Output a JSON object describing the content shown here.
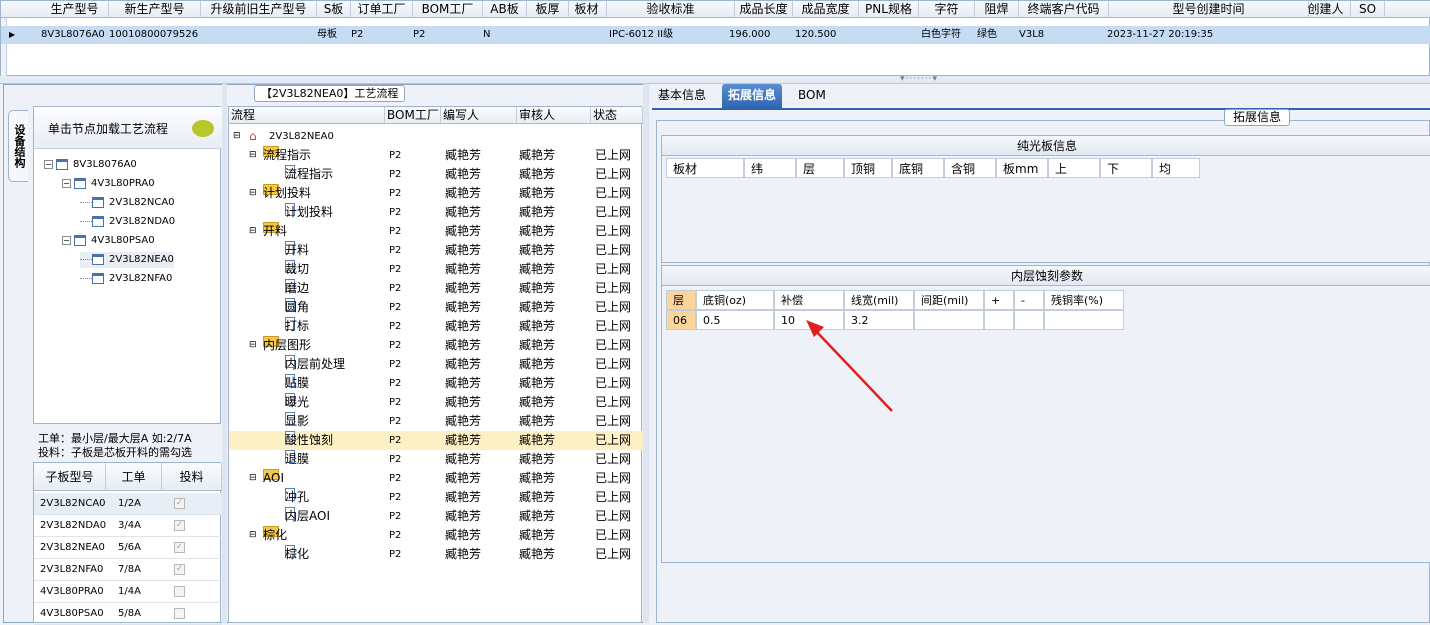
{
  "top_grid": {
    "headers": [
      "生产型号",
      "新生产型号",
      "升级前旧生产型号",
      "S板",
      "订单工厂",
      "BOM工厂",
      "AB板",
      "板厚",
      "板材",
      "验收标准",
      "成品长度",
      "成品宽度",
      "PNL规格",
      "字符",
      "阻焊",
      "终端客户代码",
      "型号创建时间",
      "创建人",
      "SO"
    ],
    "row": [
      "8V3L8076A0",
      "10010800079526",
      "",
      "母板",
      "P2",
      "P2",
      "N",
      "",
      "",
      "IPC-6012 II级",
      "196.000",
      "120.500",
      "",
      "白色字符",
      "绿色",
      "V3L8",
      "2023-11-27 20:19:35",
      "",
      ""
    ]
  },
  "left": {
    "side_tab": "设备结构",
    "process_title": "【2V3L82NEA0】工艺流程",
    "load_button": "单击节点加载工艺流程",
    "tree": [
      {
        "label": "8V3L8076A0",
        "level": 0,
        "expand": "−"
      },
      {
        "label": "4V3L80PRA0",
        "level": 1,
        "expand": "−"
      },
      {
        "label": "2V3L82NCA0",
        "level": 2,
        "expand": ""
      },
      {
        "label": "2V3L82NDA0",
        "level": 2,
        "expand": ""
      },
      {
        "label": "4V3L80PSA0",
        "level": 1,
        "expand": "−"
      },
      {
        "label": "2V3L82NEA0",
        "level": 2,
        "expand": ""
      },
      {
        "label": "2V3L82NFA0",
        "level": 2,
        "expand": ""
      }
    ],
    "note_line1": "工单：最小层/最大层A 如:2/7A",
    "note_line2": "投料：子板是芯板开料的需勾选",
    "child_table": {
      "headers": [
        "子板型号",
        "工单",
        "投料"
      ],
      "rows": [
        {
          "model": "2V3L82NCA0",
          "order": "1/2A",
          "checked": "✓"
        },
        {
          "model": "2V3L82NDA0",
          "order": "3/4A",
          "checked": "✓"
        },
        {
          "model": "2V3L82NEA0",
          "order": "5/6A",
          "checked": "✓"
        },
        {
          "model": "2V3L82NFA0",
          "order": "7/8A",
          "checked": "✓"
        },
        {
          "model": "4V3L80PRA0",
          "order": "1/4A",
          "checked": ""
        },
        {
          "model": "4V3L80PSA0",
          "order": "5/8A",
          "checked": ""
        }
      ]
    },
    "process_grid": {
      "headers": [
        "流程",
        "BOM工厂",
        "编写人",
        "审核人",
        "状态"
      ],
      "root": "2V3L82NEA0",
      "rows": [
        {
          "name": "流程指示",
          "type": "folder",
          "bom": "P2",
          "writer": "臧艳芳",
          "reviewer": "臧艳芳",
          "status": "已上网"
        },
        {
          "name": "流程指示",
          "type": "doc",
          "bom": "P2",
          "writer": "臧艳芳",
          "reviewer": "臧艳芳",
          "status": "已上网"
        },
        {
          "name": "计划投料",
          "type": "folder",
          "bom": "P2",
          "writer": "臧艳芳",
          "reviewer": "臧艳芳",
          "status": "已上网"
        },
        {
          "name": "计划投料",
          "type": "doc",
          "bom": "P2",
          "writer": "臧艳芳",
          "reviewer": "臧艳芳",
          "status": "已上网"
        },
        {
          "name": "开料",
          "type": "folder",
          "bom": "P2",
          "writer": "臧艳芳",
          "reviewer": "臧艳芳",
          "status": "已上网"
        },
        {
          "name": "开料",
          "type": "doc",
          "bom": "P2",
          "writer": "臧艳芳",
          "reviewer": "臧艳芳",
          "status": "已上网"
        },
        {
          "name": "裁切",
          "type": "doc",
          "bom": "P2",
          "writer": "臧艳芳",
          "reviewer": "臧艳芳",
          "status": "已上网"
        },
        {
          "name": "磨边",
          "type": "doc",
          "bom": "P2",
          "writer": "臧艳芳",
          "reviewer": "臧艳芳",
          "status": "已上网"
        },
        {
          "name": "圆角",
          "type": "doc",
          "bom": "P2",
          "writer": "臧艳芳",
          "reviewer": "臧艳芳",
          "status": "已上网"
        },
        {
          "name": "打标",
          "type": "doc",
          "bom": "P2",
          "writer": "臧艳芳",
          "reviewer": "臧艳芳",
          "status": "已上网"
        },
        {
          "name": "内层图形",
          "type": "folder",
          "bom": "P2",
          "writer": "臧艳芳",
          "reviewer": "臧艳芳",
          "status": "已上网"
        },
        {
          "name": "内层前处理",
          "type": "doc",
          "bom": "P2",
          "writer": "臧艳芳",
          "reviewer": "臧艳芳",
          "status": "已上网"
        },
        {
          "name": "贴膜",
          "type": "doc",
          "bom": "P2",
          "writer": "臧艳芳",
          "reviewer": "臧艳芳",
          "status": "已上网"
        },
        {
          "name": "曝光",
          "type": "doc",
          "bom": "P2",
          "writer": "臧艳芳",
          "reviewer": "臧艳芳",
          "status": "已上网"
        },
        {
          "name": "显影",
          "type": "doc",
          "bom": "P2",
          "writer": "臧艳芳",
          "reviewer": "臧艳芳",
          "status": "已上网"
        },
        {
          "name": "酸性蚀刻",
          "type": "doc",
          "bom": "P2",
          "writer": "臧艳芳",
          "reviewer": "臧艳芳",
          "status": "已上网",
          "selected": true
        },
        {
          "name": "退膜",
          "type": "doc",
          "bom": "P2",
          "writer": "臧艳芳",
          "reviewer": "臧艳芳",
          "status": "已上网"
        },
        {
          "name": "AOI",
          "type": "folder",
          "bom": "P2",
          "writer": "臧艳芳",
          "reviewer": "臧艳芳",
          "status": "已上网"
        },
        {
          "name": "冲孔",
          "type": "doc",
          "bom": "P2",
          "writer": "臧艳芳",
          "reviewer": "臧艳芳",
          "status": "已上网"
        },
        {
          "name": "内层AOI",
          "type": "doc",
          "bom": "P2",
          "writer": "臧艳芳",
          "reviewer": "臧艳芳",
          "status": "已上网"
        },
        {
          "name": "棕化",
          "type": "folder",
          "bom": "P2",
          "writer": "臧艳芳",
          "reviewer": "臧艳芳",
          "status": "已上网"
        },
        {
          "name": "棕化",
          "type": "doc",
          "bom": "P2",
          "writer": "臧艳芳",
          "reviewer": "臧艳芳",
          "status": "已上网"
        }
      ]
    }
  },
  "right": {
    "tabs": [
      "基本信息",
      "拓展信息",
      "BOM"
    ],
    "ext_header": "拓展信息",
    "plain_board": {
      "title": "纯光板信息",
      "headers": [
        "板材",
        "纬",
        "层",
        "顶铜",
        "底铜",
        "含铜",
        "板mm",
        "上",
        "下",
        "均"
      ]
    },
    "inner_etch": {
      "title": "内层蚀刻参数",
      "headers": [
        "层",
        "底铜(oz)",
        "补偿",
        "线宽(mil)",
        "间距(mil)",
        "+",
        "-",
        "残铜率(%)"
      ],
      "row": [
        "06",
        "0.5",
        "10",
        "3.2",
        "",
        "",
        "",
        ""
      ]
    }
  },
  "colors": {
    "accent": "#2f65b0",
    "selection": "#fbdc7a",
    "arrow": "#e02020"
  }
}
